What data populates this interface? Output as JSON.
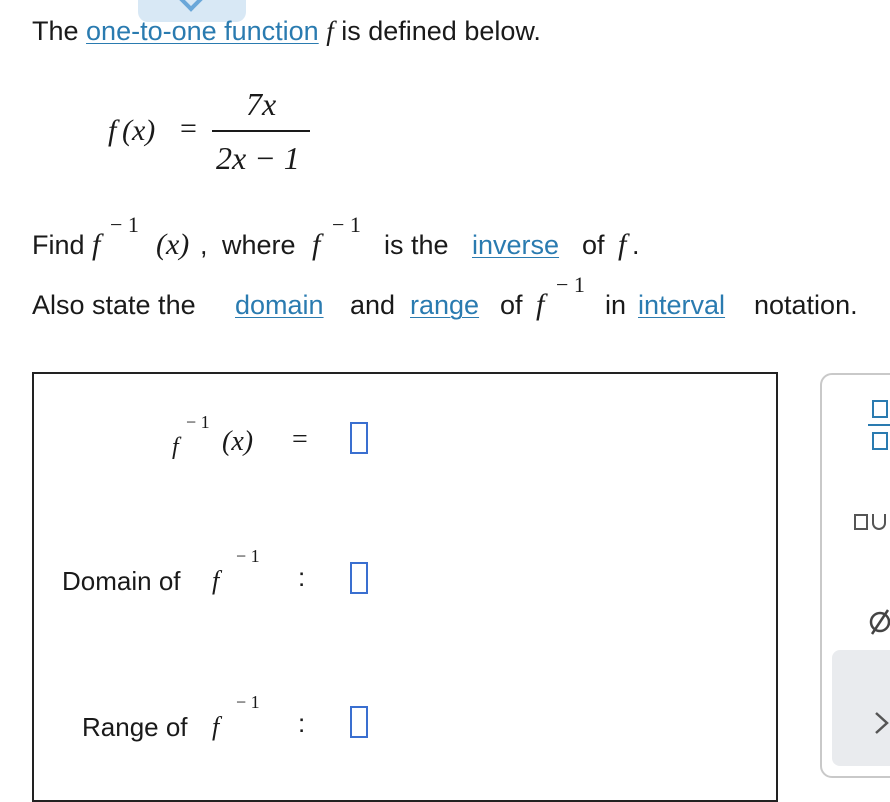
{
  "question": {
    "line1": {
      "prefix": "The ",
      "link": "one-to-one function",
      "fn": "f",
      "suffix": " is defined below."
    },
    "definition": {
      "lhs_fn": "f",
      "lhs_arg": "(x)",
      "equals": "=",
      "numerator": "7x",
      "denominator": "2x − 1"
    },
    "line2": {
      "find": "Find",
      "fn": "f",
      "sup": "− 1",
      "arg": "(x)",
      "comma": ",",
      "where": "where",
      "fn2": "f",
      "sup2": "− 1",
      "is_the": "is the",
      "link": "inverse",
      "of": "of",
      "fn3": "f",
      "period": "."
    },
    "line3": {
      "also": "Also state the",
      "link_domain": "domain",
      "and": "and",
      "link_range": "range",
      "of": "of",
      "fn": "f",
      "sup": "− 1",
      "in": "in",
      "link_interval": "interval",
      "notation": "notation."
    }
  },
  "answer": {
    "inverse_row": {
      "fn": "f",
      "sup": "− 1",
      "arg": "(x)",
      "equals": "="
    },
    "domain_row": {
      "label": "Domain of",
      "fn": "f",
      "sup": "− 1",
      "colon": ":"
    },
    "range_row": {
      "label": "Range of",
      "fn": "f",
      "sup": "− 1",
      "colon": ":"
    }
  },
  "palette": {
    "icons": [
      "fraction-icon",
      "interval-icon",
      "empty-set-icon",
      "chevron-right-icon"
    ],
    "accent": "#2a7bb0"
  }
}
